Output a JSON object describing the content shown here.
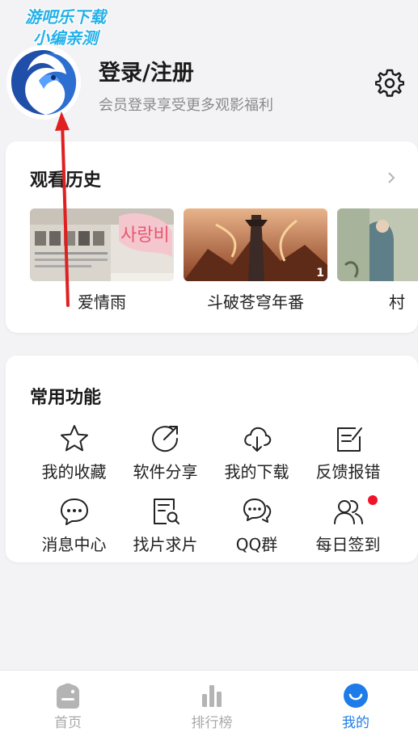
{
  "watermark": {
    "line1": "游吧乐下载",
    "line2": "小编亲测"
  },
  "profile": {
    "title": "登录/注册",
    "subtitle": "会员登录享受更多观影福利"
  },
  "history": {
    "title": "观看历史",
    "items": [
      {
        "title": "爱情雨",
        "art_text": "사랑비",
        "badge": ""
      },
      {
        "title": "斗破苍穹年番",
        "badge": "1"
      },
      {
        "title": "村",
        "badge": ""
      }
    ]
  },
  "functions": {
    "title": "常用功能",
    "items": [
      {
        "label": "我的收藏",
        "icon": "star-icon"
      },
      {
        "label": "软件分享",
        "icon": "share-icon"
      },
      {
        "label": "我的下载",
        "icon": "cloud-download-icon"
      },
      {
        "label": "反馈报错",
        "icon": "feedback-icon"
      },
      {
        "label": "消息中心",
        "icon": "message-icon"
      },
      {
        "label": "找片求片",
        "icon": "search-file-icon"
      },
      {
        "label": "QQ群",
        "icon": "chat-group-icon"
      },
      {
        "label": "每日签到",
        "icon": "users-icon",
        "has_dot": true
      }
    ]
  },
  "bottom_nav": {
    "items": [
      {
        "label": "首页",
        "icon": "home-icon",
        "active": false
      },
      {
        "label": "排行榜",
        "icon": "ranking-icon",
        "active": false
      },
      {
        "label": "我的",
        "icon": "profile-smile-icon",
        "active": true
      }
    ]
  },
  "colors": {
    "accent": "#1e7ce8",
    "watermark": "#23b0e8",
    "dot": "#f0142a",
    "background": "#f3f3f5",
    "arrow": "#e02020"
  }
}
